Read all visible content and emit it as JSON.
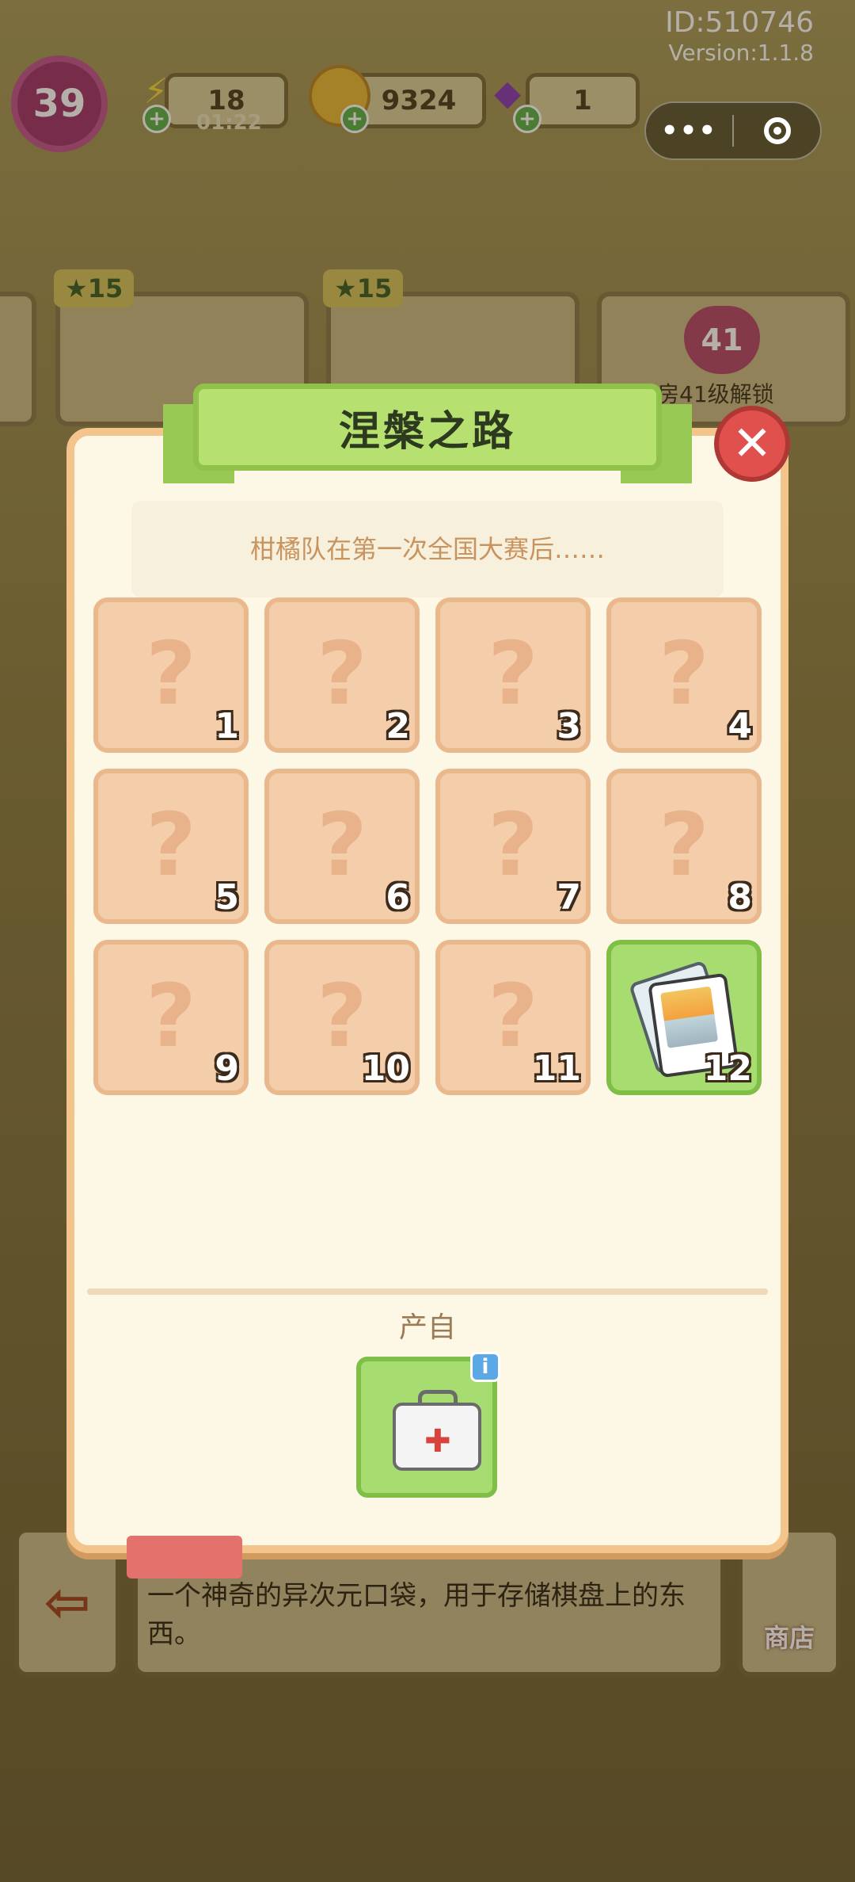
{
  "hud": {
    "id_text": "ID:510746",
    "version_text": "Version:1.1.8",
    "level": "39",
    "energy": "18",
    "energy_timer": "01:22",
    "coins": "9324",
    "gems": "1"
  },
  "tasks": {
    "card1_stars": "15",
    "card2_stars": "15",
    "heart_level": "41",
    "unlock_text": "房41级解锁"
  },
  "modal": {
    "title": "涅槃之路",
    "subtitle": "柑橘队在第一次全国大赛后……",
    "tiles": [
      {
        "num": "1",
        "symbol": "?"
      },
      {
        "num": "2",
        "symbol": "?"
      },
      {
        "num": "3",
        "symbol": "?"
      },
      {
        "num": "4",
        "symbol": "?"
      },
      {
        "num": "5",
        "symbol": "?"
      },
      {
        "num": "6",
        "symbol": "?"
      },
      {
        "num": "7",
        "symbol": "?"
      },
      {
        "num": "8",
        "symbol": "?"
      },
      {
        "num": "9",
        "symbol": "?"
      },
      {
        "num": "10",
        "symbol": "?"
      },
      {
        "num": "11",
        "symbol": "?"
      },
      {
        "num": "12",
        "symbol": ""
      }
    ],
    "from_label": "产自",
    "info_symbol": "i",
    "close_symbol": "✕"
  },
  "bottom": {
    "description": "一个神奇的异次元口袋，用于存储棋盘上的东西。",
    "shop_label": "商店",
    "exit_symbol": "⇦"
  },
  "colors": {
    "modal_bg": "#fdf8e6",
    "tile_locked": "#f4ceaa",
    "tile_unlocked": "#a7dc70",
    "ribbon": "#b6e06f",
    "close": "#e0504c"
  }
}
